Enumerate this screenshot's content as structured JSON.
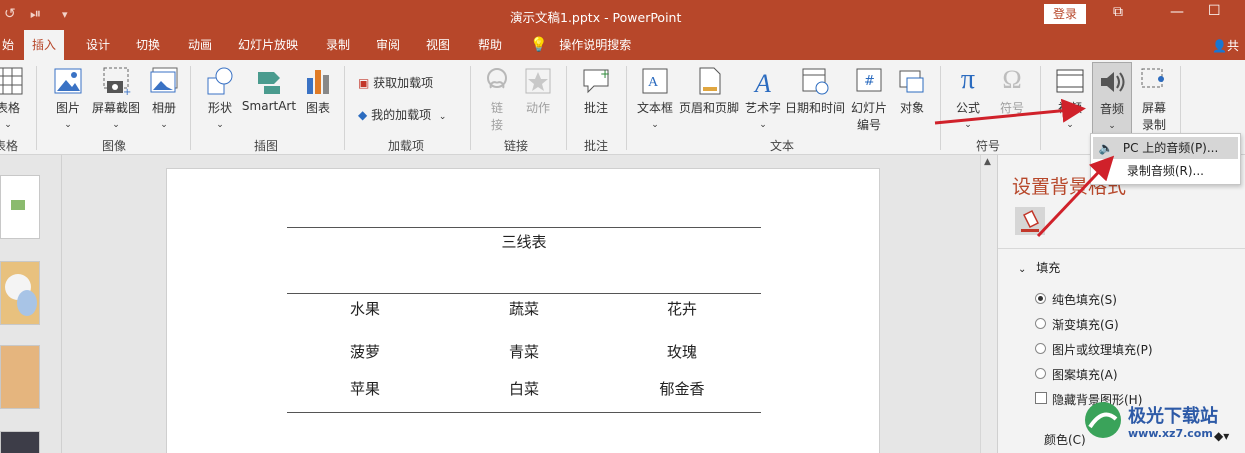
{
  "titlebar": {
    "title": "演示文稿1.pptx  -  PowerPoint",
    "login_label": "登录",
    "restore_icon": "restore-icon",
    "minimize_icon": "minimize-icon",
    "accent_color": "#b7472a"
  },
  "tabs": {
    "items": [
      "始",
      "插入",
      "设计",
      "切换",
      "动画",
      "幻灯片放映",
      "录制",
      "审阅",
      "视图",
      "帮助"
    ],
    "active": "插入",
    "tell_me": "操作说明搜索",
    "share": "共"
  },
  "ribbon": {
    "table_group": {
      "button": "表格",
      "label": "表格"
    },
    "images_group": {
      "buttons": [
        "图片",
        "屏幕截图",
        "相册"
      ],
      "label": "图像"
    },
    "illustrations_group": {
      "buttons": [
        "形状",
        "SmartArt",
        "图表"
      ],
      "label": "插图"
    },
    "addins_group": {
      "get_addins": "获取加载项",
      "my_addins": "我的加载项",
      "label": "加载项"
    },
    "links_group": {
      "link_line1": "链",
      "link_line2": "接",
      "action": "动作",
      "label": "链接"
    },
    "comments_group": {
      "comment": "批注",
      "label": "批注"
    },
    "text_group": {
      "buttons": [
        "文本框",
        "页眉和页脚",
        "艺术字",
        "日期和时间"
      ],
      "slide_number_line1": "幻灯片",
      "slide_number_line2": "编号",
      "object": "对象",
      "label": "文本"
    },
    "symbols_group": {
      "equation": "公式",
      "symbol": "符号",
      "label": "符号"
    },
    "media_group": {
      "video": "视频",
      "audio": "音频",
      "screen_record_line1": "屏幕",
      "screen_record_line2": "录制"
    }
  },
  "audio_dropdown": {
    "items": [
      {
        "label": "PC 上的音频(P)...",
        "highlighted": true
      },
      {
        "label": "录制音频(R)...",
        "highlighted": false
      }
    ]
  },
  "slide": {
    "title": "三线表",
    "rows": [
      [
        "水果",
        "蔬菜",
        "花卉"
      ],
      [
        "菠萝",
        "青菜",
        "玫瑰"
      ],
      [
        "苹果",
        "白菜",
        "郁金香"
      ]
    ]
  },
  "format_pane": {
    "title": "设置背景格式",
    "section": "填充",
    "options": [
      {
        "label": "纯色填充(S)",
        "checked": true
      },
      {
        "label": "渐变填充(G)",
        "checked": false
      },
      {
        "label": "图片或纹理填充(P)",
        "checked": false
      },
      {
        "label": "图案填充(A)",
        "checked": false
      }
    ],
    "hide_bg_label": "隐藏背景图形(H)",
    "color_label": "颜色(C)"
  },
  "watermark": {
    "name": "极光下载站",
    "url": "www.xz7.com"
  },
  "colors": {
    "accent": "#b7472a",
    "arrow": "#d0212a"
  }
}
